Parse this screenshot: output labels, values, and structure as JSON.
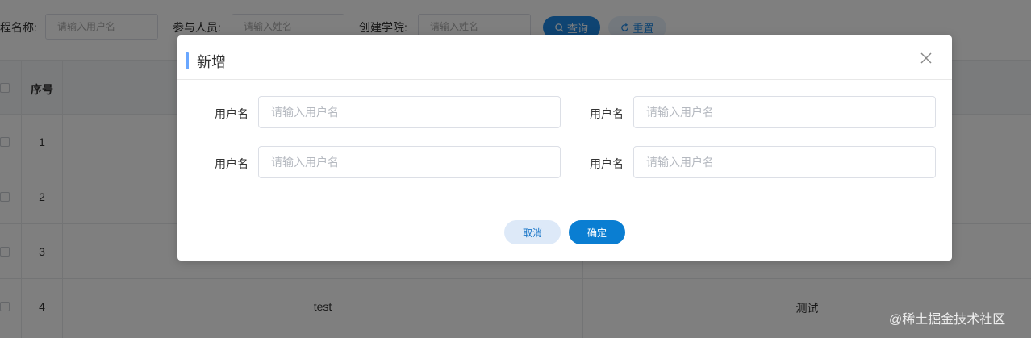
{
  "filters": {
    "course_label": "程名称:",
    "course_placeholder": "请输入用户名",
    "participant_label": "参与人员:",
    "participant_placeholder": "请输入姓名",
    "college_label": "创建学院:",
    "college_placeholder": "请输入姓名",
    "query_label": "查询",
    "reset_label": "重置"
  },
  "table": {
    "seq_header": "序号",
    "rows": [
      {
        "num": "1",
        "name": "",
        "desc": ""
      },
      {
        "num": "2",
        "name": "",
        "desc": ""
      },
      {
        "num": "3",
        "name": "",
        "desc": ""
      },
      {
        "num": "4",
        "name": "test",
        "desc": "测试"
      }
    ]
  },
  "dialog": {
    "title": "新增",
    "fields": [
      {
        "label": "用户名",
        "placeholder": "请输入用户名"
      },
      {
        "label": "用户名",
        "placeholder": "请输入用户名"
      },
      {
        "label": "用户名",
        "placeholder": "请输入用户名"
      },
      {
        "label": "用户名",
        "placeholder": "请输入用户名"
      }
    ],
    "cancel_label": "取消",
    "ok_label": "确定"
  },
  "watermark": "@稀土掘金技术社区",
  "colors": {
    "accent": "#0a7ed2",
    "title_bar": "#6aa7ff"
  }
}
